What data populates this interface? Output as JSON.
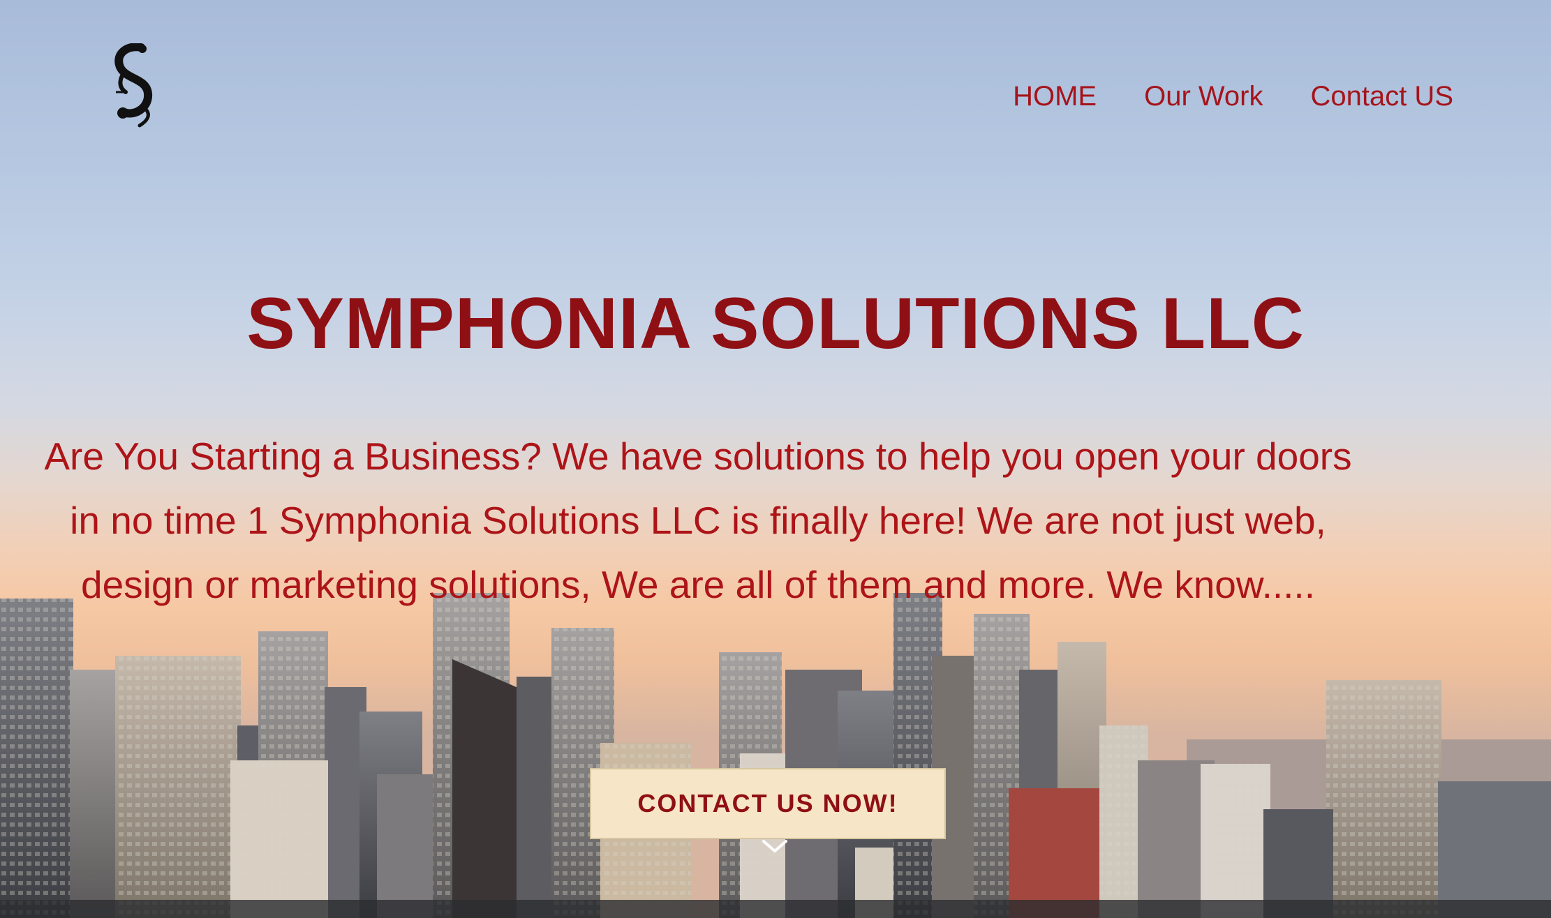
{
  "brand": {
    "logo_icon": "treble-s-logo-icon"
  },
  "nav": {
    "items": [
      {
        "label": "HOME"
      },
      {
        "label": "Our Work"
      },
      {
        "label": "Contact US"
      }
    ]
  },
  "hero": {
    "title": "SYMPHONIA SOLUTIONS LLC",
    "tagline": "Are You Starting a Business? We have solutions to help you open your doors in no time 1 Symphonia Solutions LLC is finally here! We are not just web, design or marketing solutions, We are all of them and more. We know.....",
    "cta_label": "CONTACT US NOW!",
    "scroll_icon": "chevron-down-icon"
  },
  "colors": {
    "accent": "#a5141a",
    "title": "#8f1014",
    "cta_bg": "#f7e5c7"
  }
}
